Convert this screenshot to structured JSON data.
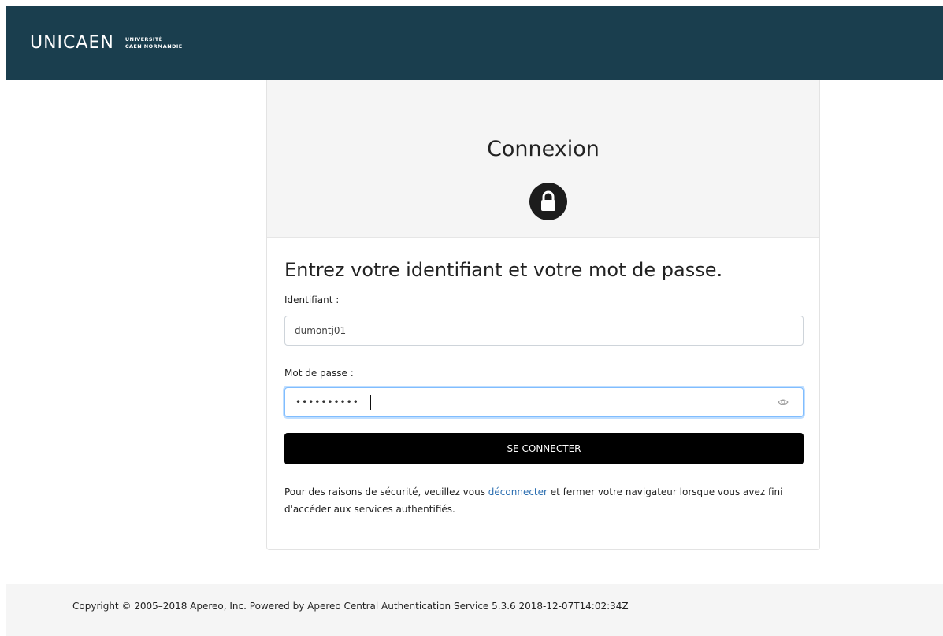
{
  "header": {
    "logo_mark": "UNICAEN",
    "logo_line1": "UNIVERSITÉ",
    "logo_line2": "CAEN NORMANDIE",
    "background": "#1a3e4e"
  },
  "login": {
    "title": "Connexion",
    "icon": "lock-icon",
    "instructions": "Entrez votre identifiant et votre mot de passe.",
    "username_label": "Identifiant :",
    "username_value": "dumontj01",
    "password_label": "Mot de passe :",
    "password_value": "••••••••••",
    "submit_label": "SE CONNECTER",
    "notice_before": "Pour des raisons de sécurité, veuillez vous ",
    "notice_link": "déconnecter",
    "notice_after": " et fermer votre navigateur lorsque vous avez fini d'accéder aux services authentifiés."
  },
  "footer": {
    "copyright": "Copyright © 2005–2018 Apereo, Inc. Powered by Apereo Central Authentication Service 5.3.6 2018-12-07T14:02:34Z"
  }
}
